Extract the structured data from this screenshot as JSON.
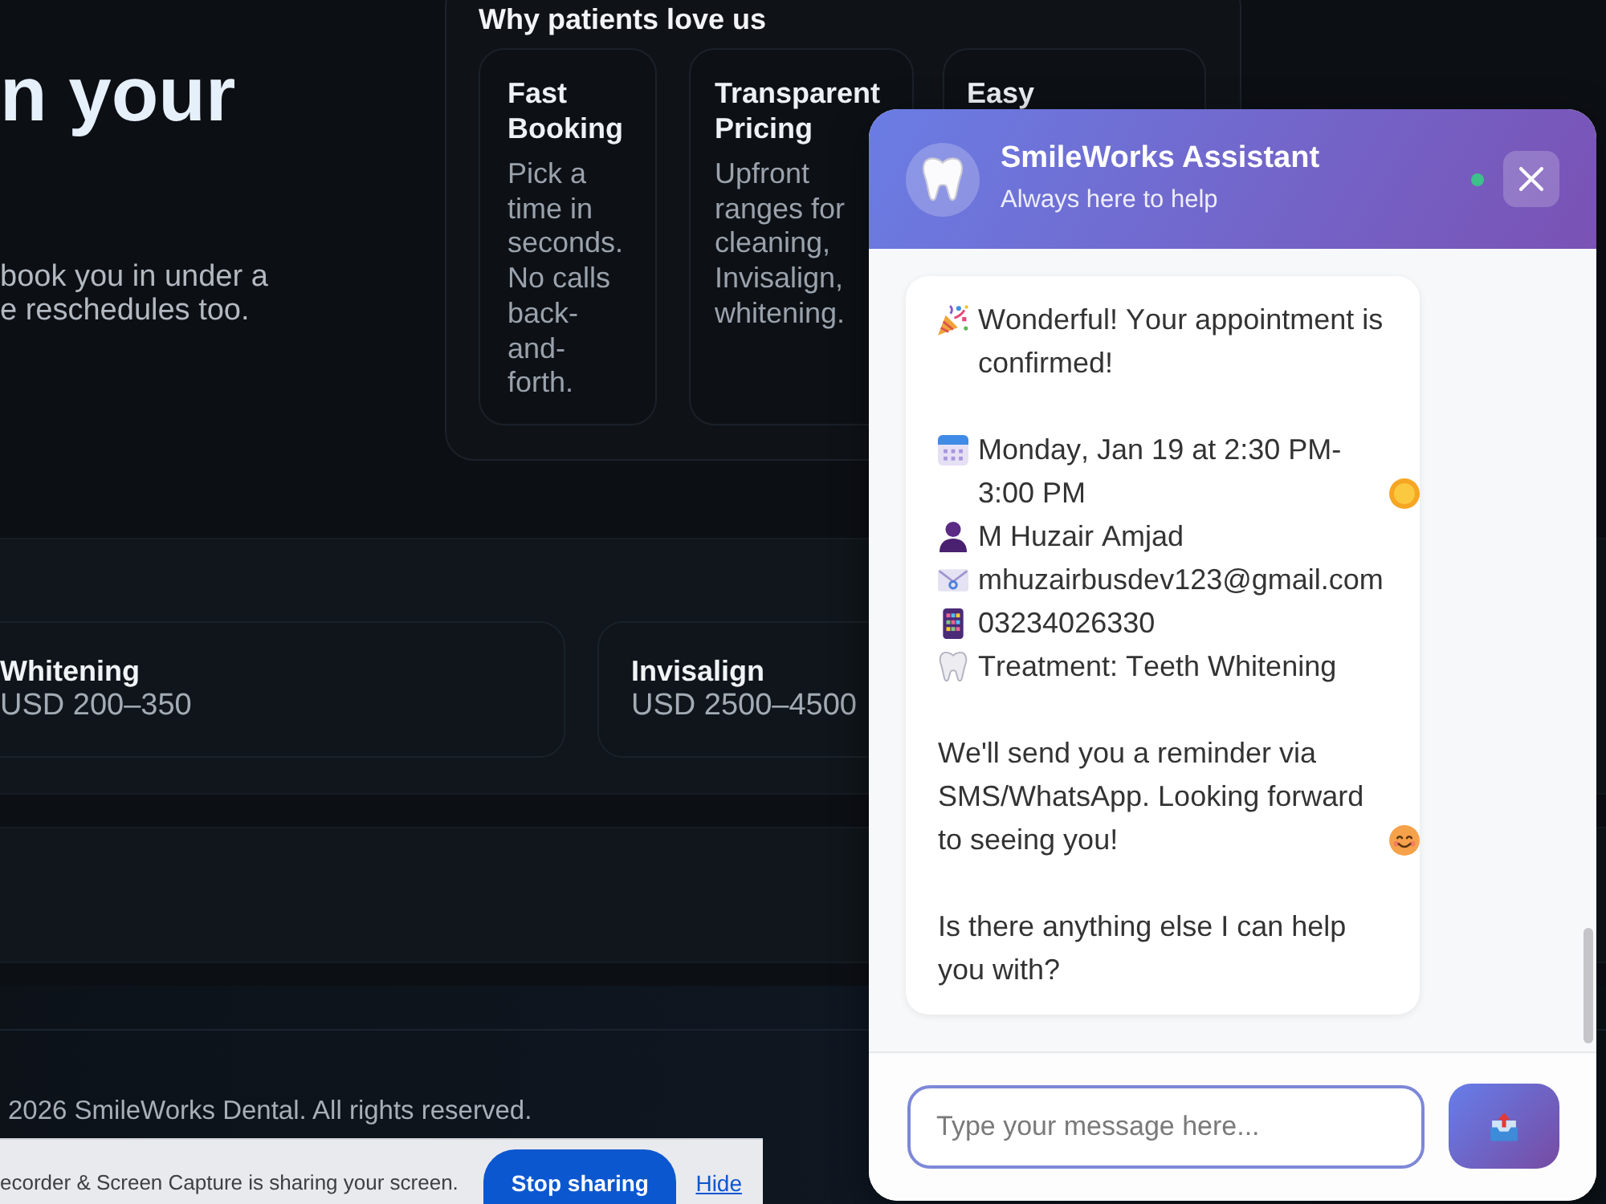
{
  "hero": {
    "title": "n your",
    "subtitle": "book you in under a\ne reschedules too."
  },
  "features": {
    "title": "Why patients love us",
    "cards": [
      {
        "title": "Fast Booking",
        "description": "Pick a time in seconds. No calls back-and-forth."
      },
      {
        "title": "Transparent Pricing",
        "description": "Upfront ranges for cleaning, Invisalign, whitening."
      },
      {
        "title": "Easy"
      }
    ]
  },
  "services": {
    "cards": [
      {
        "name": "Whitening",
        "price": "USD 200–350"
      },
      {
        "name": "Invisalign",
        "price": "USD 2500–4500"
      }
    ]
  },
  "footer": {
    "copyright": "2026 SmileWorks Dental. All rights reserved."
  },
  "screen_share_bar": {
    "message": "ecorder & Screen Capture is sharing your screen.",
    "stop_button": "Stop sharing",
    "hide_link": "Hide"
  },
  "chat": {
    "title": "SmileWorks Assistant",
    "subtitle": "Always here to help",
    "online": true,
    "message": {
      "paragraphs": [
        {
          "lines": [
            {
              "kind": "celebration",
              "text": "Wonderful! Your appointment is confirmed!"
            }
          ]
        },
        {
          "lines": [
            {
              "kind": "schedule",
              "text": "Monday, Jan 19 at 2:30 PM-3:00 PM"
            },
            {
              "kind": "patient",
              "text": "M Huzair Amjad"
            },
            {
              "kind": "email",
              "text": "mhuzairbusdev123@gmail.com"
            },
            {
              "kind": "phone",
              "text": "03234026330"
            },
            {
              "kind": "treatment",
              "text": "Treatment: Teeth Whitening"
            }
          ]
        },
        {
          "lines": [
            {
              "kind": "closing",
              "text": "We'll send you a reminder via SMS/WhatsApp. Looking forward to seeing you!"
            }
          ]
        },
        {
          "lines": [
            {
              "kind": "plain",
              "text": "Is there anything else I can help you with?"
            }
          ]
        }
      ]
    },
    "input": {
      "placeholder": "Type your message here..."
    }
  }
}
